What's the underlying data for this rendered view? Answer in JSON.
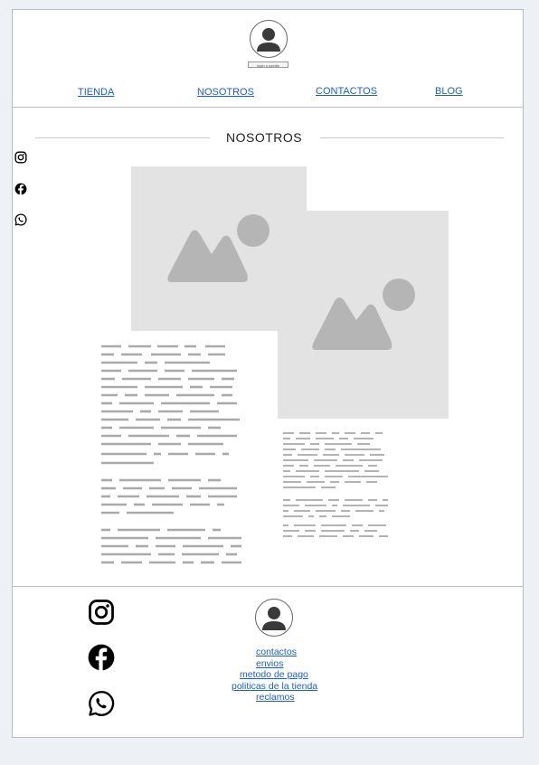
{
  "header": {
    "login_label": "login o sumite",
    "nav": [
      "TIENDA",
      "NOSOTROS",
      "CONTACTOS",
      "BLOG"
    ]
  },
  "main": {
    "section_title": "NOSOTROS",
    "social_icons": [
      "instagram-icon",
      "facebook-icon",
      "whatsapp-icon"
    ]
  },
  "footer": {
    "social_icons": [
      "instagram-icon",
      "facebook-icon",
      "whatsapp-icon"
    ],
    "links": [
      "contactos",
      "envios",
      "metodo de pago",
      "politicas de la tienda",
      "reclamos"
    ]
  },
  "colors": {
    "link": "#1a5fc4",
    "border": "#b9bcc2",
    "placeholder_bg": "#e3e3e3",
    "placeholder_shape": "#b5b5b5",
    "page_bg": "#edf0f5"
  }
}
